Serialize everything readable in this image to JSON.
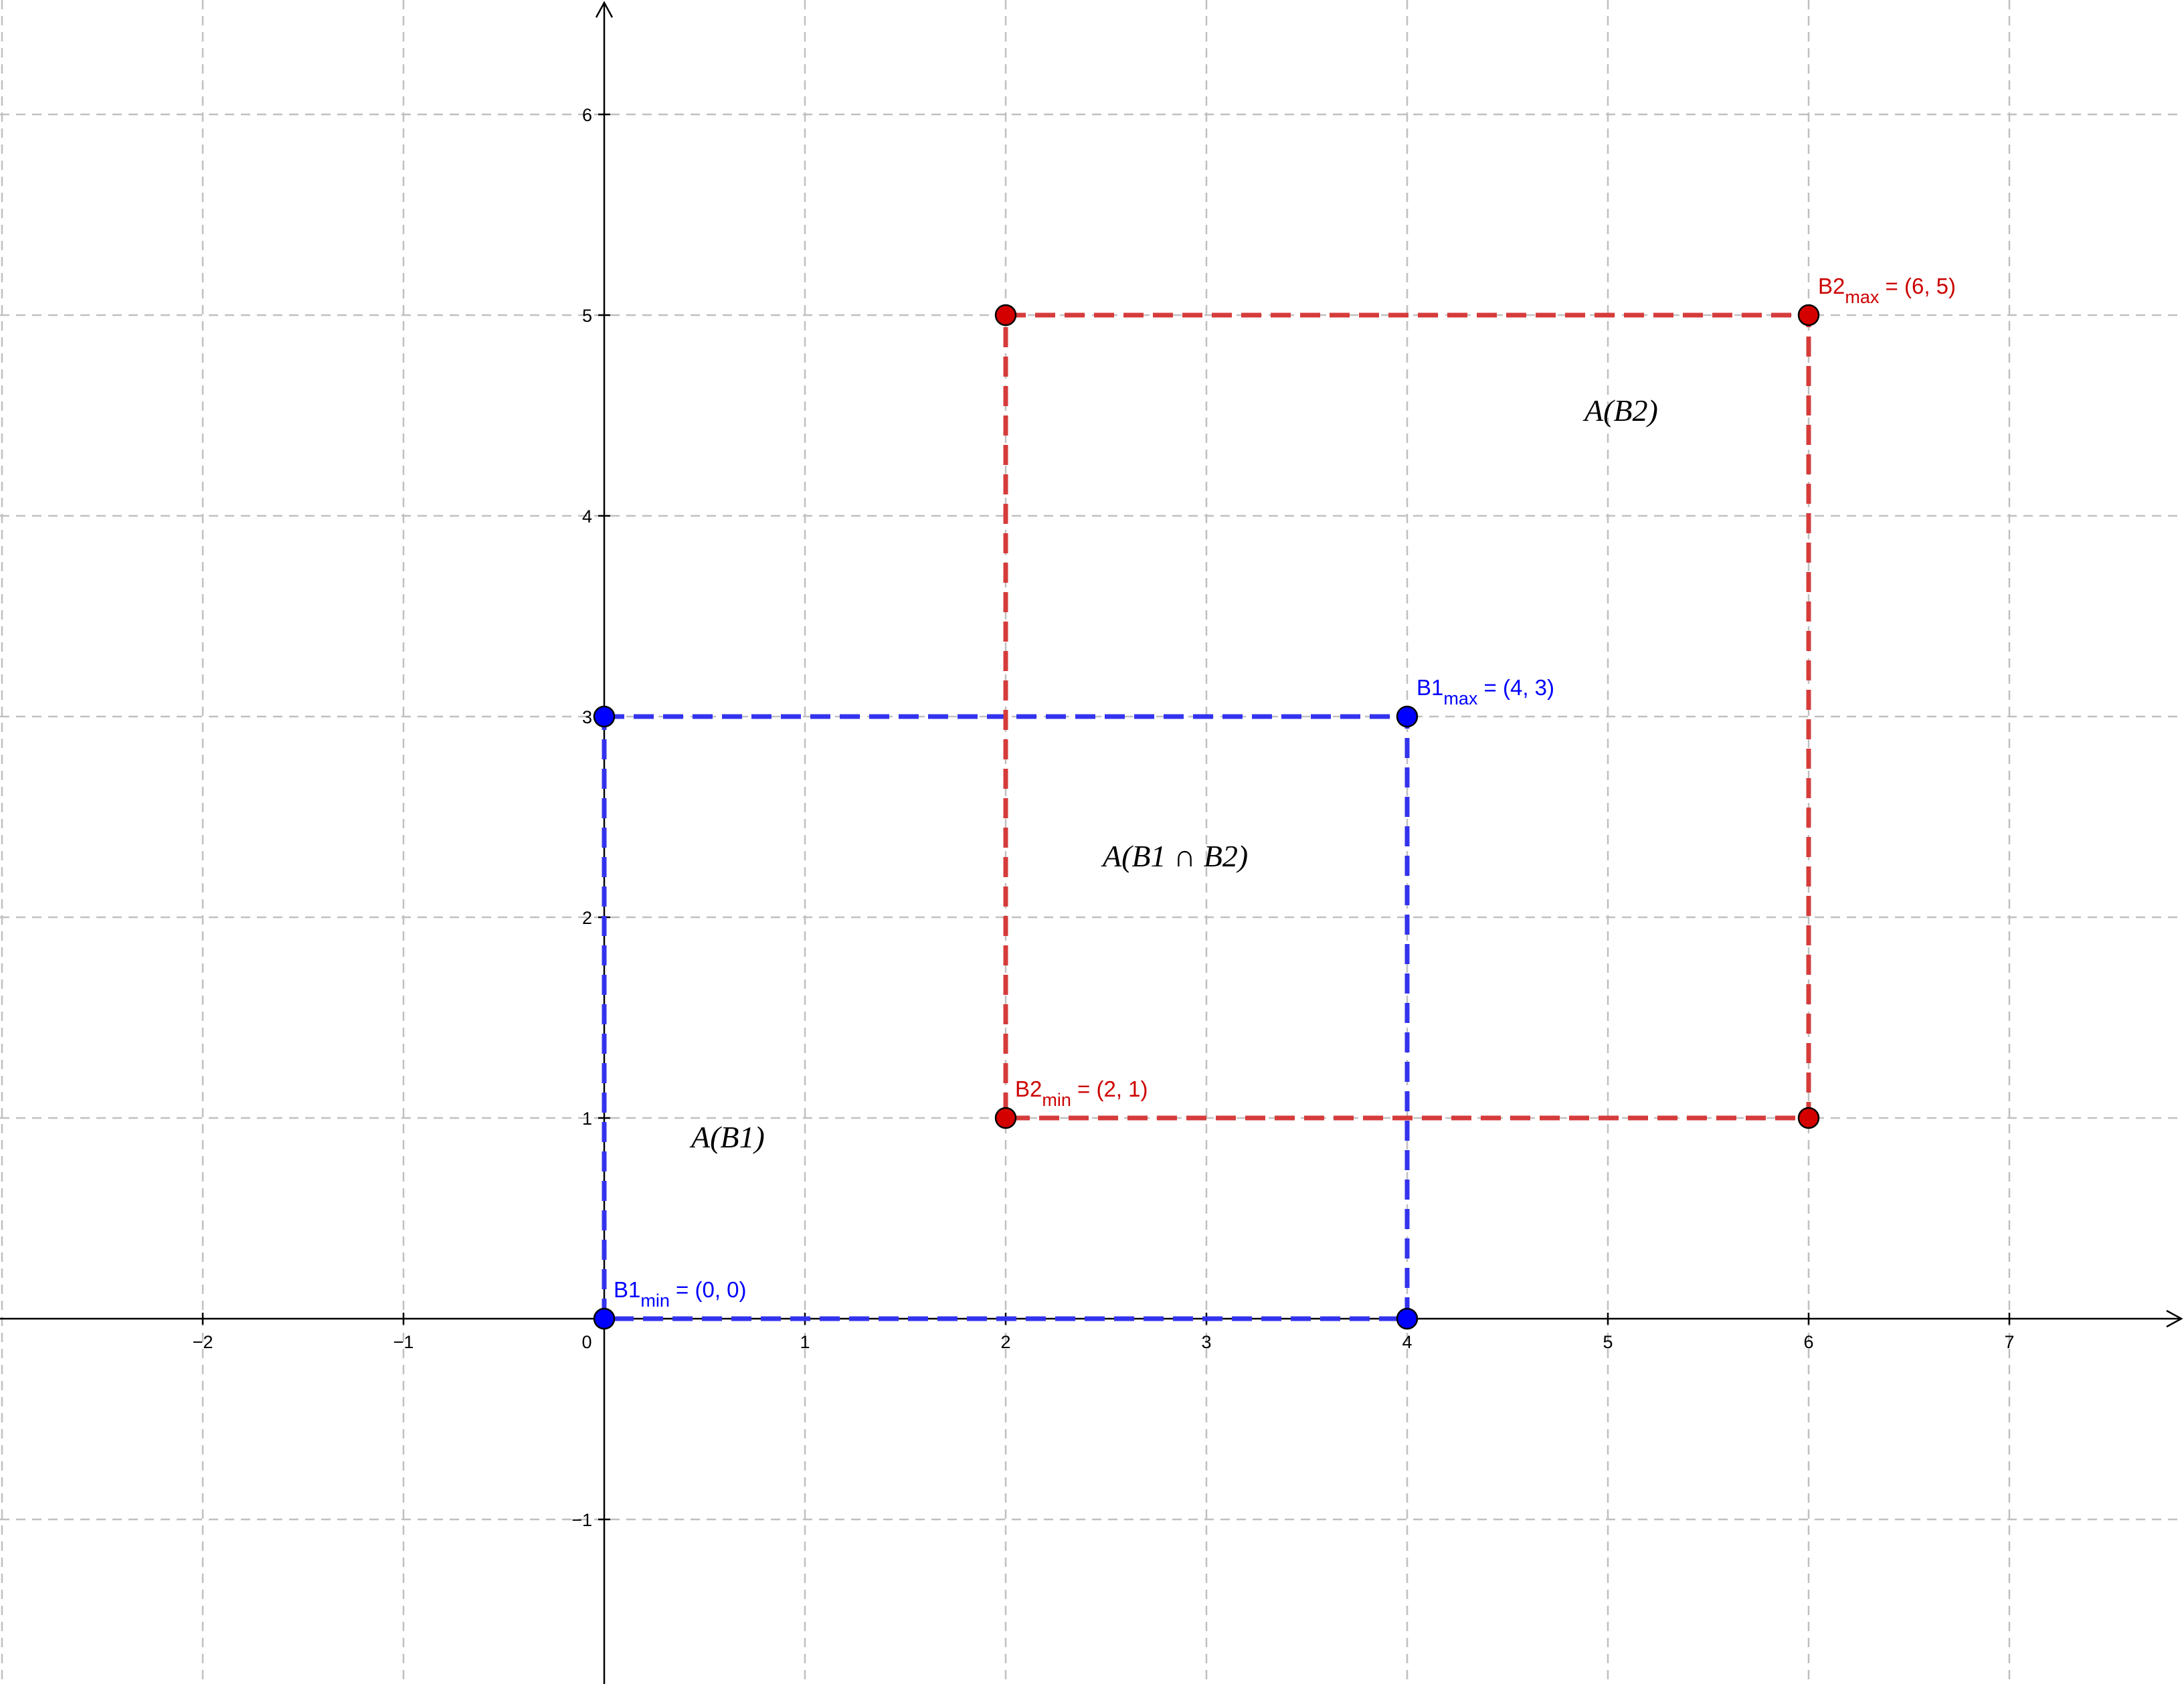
{
  "chart_data": {
    "type": "scatter",
    "xlim": [
      -3,
      7.9
    ],
    "ylim": [
      -1.8,
      6.55
    ],
    "grid": true,
    "x_ticks": [
      {
        "value": -2,
        "label": "−2"
      },
      {
        "value": -1,
        "label": "−1"
      },
      {
        "value": 0,
        "label": "0"
      },
      {
        "value": 1,
        "label": "1"
      },
      {
        "value": 2,
        "label": "2"
      },
      {
        "value": 3,
        "label": "3"
      },
      {
        "value": 4,
        "label": "4"
      },
      {
        "value": 5,
        "label": "5"
      },
      {
        "value": 6,
        "label": "6"
      },
      {
        "value": 7,
        "label": "7"
      }
    ],
    "y_ticks": [
      {
        "value": -1,
        "label": "−1"
      },
      {
        "value": 1,
        "label": "1"
      },
      {
        "value": 2,
        "label": "2"
      },
      {
        "value": 3,
        "label": "3"
      },
      {
        "value": 4,
        "label": "4"
      },
      {
        "value": 5,
        "label": "5"
      },
      {
        "value": 6,
        "label": "6"
      }
    ],
    "rectangles": [
      {
        "id": "b1",
        "color": "#3333ee",
        "min": [
          0,
          0
        ],
        "max": [
          4,
          3
        ]
      },
      {
        "id": "b2",
        "color": "#d63b3b",
        "min": [
          2,
          1
        ],
        "max": [
          6,
          5
        ]
      }
    ],
    "points": [
      {
        "x": 0,
        "y": 0,
        "color": "#0000ff"
      },
      {
        "x": 4,
        "y": 0,
        "color": "#0000ff"
      },
      {
        "x": 0,
        "y": 3,
        "color": "#0000ff"
      },
      {
        "x": 4,
        "y": 3,
        "color": "#0000ff"
      },
      {
        "x": 2,
        "y": 1,
        "color": "#d40000"
      },
      {
        "x": 6,
        "y": 1,
        "color": "#d40000"
      },
      {
        "x": 2,
        "y": 5,
        "color": "#d40000"
      },
      {
        "x": 6,
        "y": 5,
        "color": "#d40000"
      }
    ],
    "point_labels": [
      {
        "id": "b1min",
        "anchor": [
          0,
          0
        ],
        "color": "#0000ff",
        "base": "B1",
        "sub": "min",
        "rest": " = (0, 0)"
      },
      {
        "id": "b1max",
        "anchor": [
          4,
          3
        ],
        "color": "#0000ff",
        "base": "B1",
        "sub": "max",
        "rest": " = (4, 3)"
      },
      {
        "id": "b2min",
        "anchor": [
          2,
          1
        ],
        "color": "#cc0000",
        "base": "B2",
        "sub": "min",
        "rest": " = (2, 1)"
      },
      {
        "id": "b2max",
        "anchor": [
          6,
          5
        ],
        "color": "#cc0000",
        "base": "B2",
        "sub": "max",
        "rest": " = (6, 5)"
      }
    ],
    "area_labels": [
      {
        "id": "ab1",
        "text": "A(B1)",
        "at": [
          0.5,
          0.9
        ]
      },
      {
        "id": "ab2",
        "text": "A(B2)",
        "at": [
          4.95,
          4.52
        ]
      },
      {
        "id": "ab1b2",
        "text": "A(B1 ∩ B2)",
        "at": [
          2.55,
          2.3
        ]
      }
    ]
  }
}
